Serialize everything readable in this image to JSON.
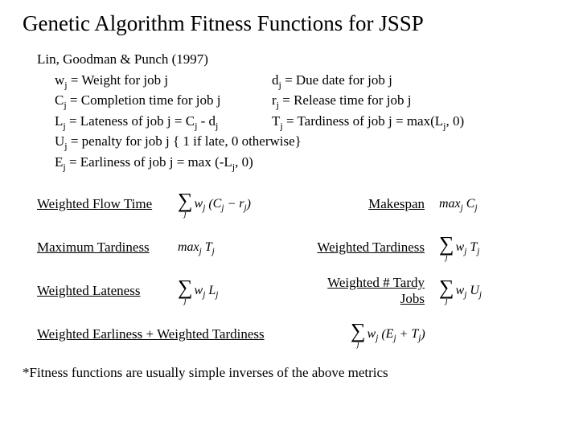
{
  "title": "Genetic Algorithm Fitness Functions for JSSP",
  "citation": "Lin, Goodman & Punch (1997)",
  "defs": {
    "w": {
      "sym": "w",
      "text": " = Weight for job j"
    },
    "d": {
      "sym": "d",
      "text": " = Due date for job j"
    },
    "C": {
      "sym": "C",
      "text": " = Completion time for job j"
    },
    "r": {
      "sym": "r",
      "text": " = Release time for job j"
    },
    "L": {
      "sym": "L",
      "text": " = Lateness of job j = C",
      "tail": "  - d"
    },
    "T": {
      "sym": "T",
      "text": " = Tardiness of job j = max(L",
      "tail": ", 0)"
    },
    "U": {
      "sym": "U",
      "text": " = penalty for job j { 1 if  late, 0 otherwise}"
    },
    "E": {
      "sym": "E",
      "text": " = Earliness of job j = max (-L",
      "tail": ", 0)"
    }
  },
  "metrics": {
    "wft": "Weighted Flow Time",
    "makespan": "Makespan",
    "maxtard": "Maximum Tardiness",
    "wtard": "Weighted Tardiness",
    "wlate": "Weighted Lateness",
    "wtardyjobs": "Weighted # Tardy Jobs",
    "combo": "Weighted Earliness + Weighted Tardiness"
  },
  "formulas": {
    "wft": "w<sub>j</sub> (C<sub>j</sub> − r<sub>j</sub>)",
    "makespan": "max<sub>j</sub> C<sub>j</sub>",
    "maxtard": "max<sub>j</sub> T<sub>j</sub>",
    "wtard": "w<sub>j</sub> T<sub>j</sub>",
    "wlate": "w<sub>j</sub> L<sub>j</sub>",
    "wtardyjobs": "w<sub>j</sub> U<sub>j</sub>",
    "combo": "w<sub>j</sub> (E<sub>j</sub> + T<sub>j</sub>)"
  },
  "footnote": "*Fitness functions are usually simple inverses of the above metrics"
}
